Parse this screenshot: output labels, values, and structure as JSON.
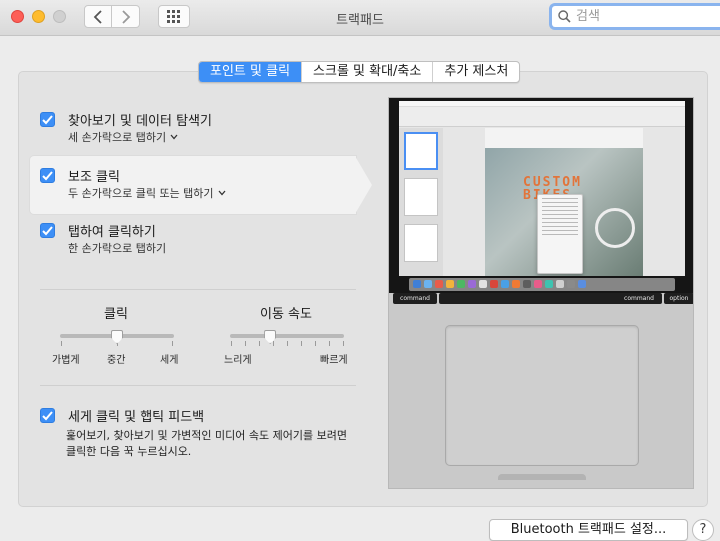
{
  "window": {
    "title": "트랙패드",
    "search_placeholder": "검색"
  },
  "tabs": [
    {
      "label": "포인트 및 클릭",
      "active": true
    },
    {
      "label": "스크롤 및 확대/축소",
      "active": false
    },
    {
      "label": "추가 제스처",
      "active": false
    }
  ],
  "options": [
    {
      "title": "찾아보기 및 데이터 탐색기",
      "subtitle": "세 손가락으로 탭하기",
      "checked": true,
      "has_dropdown": true
    },
    {
      "title": "보조 클릭",
      "subtitle": "두 손가락으로 클릭 또는 탭하기",
      "checked": true,
      "has_dropdown": true,
      "selected": true
    },
    {
      "title": "탭하여 클릭하기",
      "subtitle": "한 손가락으로 탭하기",
      "checked": true,
      "has_dropdown": false
    }
  ],
  "sliders": {
    "click": {
      "title": "클릭",
      "labels": [
        "가볍게",
        "중간",
        "세게"
      ],
      "value": "중간"
    },
    "tracking": {
      "title": "이동 속도",
      "min_label": "느리게",
      "max_label": "빠르게",
      "value": 0.35
    }
  },
  "force_click": {
    "title": "세게 클릭 및 햅틱 피드백",
    "checked": true,
    "description_line1": "훑어보기, 찾아보기 및 가변적인 미디어 속도 제어기를 보려면",
    "description_line2": "클릭한 다음 꾹 누르십시오."
  },
  "preview": {
    "doc_text_line1": "CUSTOM",
    "doc_text_line2": "BIKES",
    "keys": {
      "left_command": "command",
      "right_command": "command",
      "option": "option"
    }
  },
  "footer": {
    "bluetooth_button": "Bluetooth 트랙패드 설정...",
    "help_button": "?"
  },
  "colors": {
    "accent": "#3d8ff6",
    "close": "#fd5f57",
    "minimize": "#febc2e"
  }
}
